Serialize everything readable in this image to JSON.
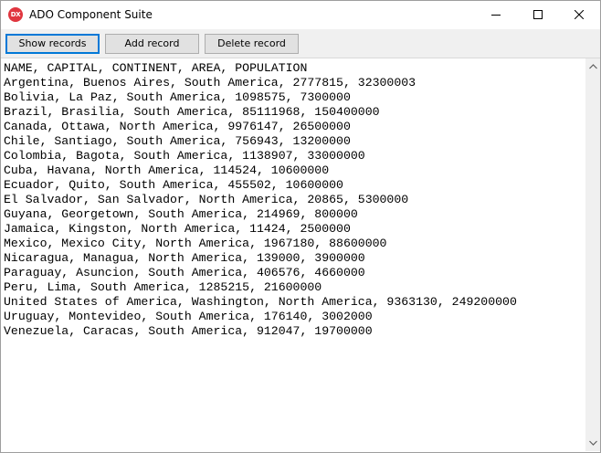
{
  "window": {
    "title": "ADO Component Suite",
    "icon_text": "DX",
    "icon_color": "#e0363f"
  },
  "toolbar": {
    "show_label": "Show records",
    "add_label": "Add record",
    "delete_label": "Delete record"
  },
  "memo": {
    "lines": [
      "NAME, CAPITAL, CONTINENT, AREA, POPULATION",
      "Argentina, Buenos Aires, South America, 2777815, 32300003",
      "Bolivia, La Paz, South America, 1098575, 7300000",
      "Brazil, Brasilia, South America, 85111968, 150400000",
      "Canada, Ottawa, North America, 9976147, 26500000",
      "Chile, Santiago, South America, 756943, 13200000",
      "Colombia, Bagota, South America, 1138907, 33000000",
      "Cuba, Havana, North America, 114524, 10600000",
      "Ecuador, Quito, South America, 455502, 10600000",
      "El Salvador, San Salvador, North America, 20865, 5300000",
      "Guyana, Georgetown, South America, 214969, 800000",
      "Jamaica, Kingston, North America, 11424, 2500000",
      "Mexico, Mexico City, North America, 1967180, 88600000",
      "Nicaragua, Managua, North America, 139000, 3900000",
      "Paraguay, Asuncion, South America, 406576, 4660000",
      "Peru, Lima, South America, 1285215, 21600000",
      "United States of America, Washington, North America, 9363130, 249200000",
      "Uruguay, Montevideo, South America, 176140, 3002000",
      "Venezuela, Caracas, South America, 912047, 19700000"
    ]
  },
  "icons": {
    "minimize": "minimize-icon",
    "maximize": "maximize-icon",
    "close": "close-icon",
    "scroll_up": "scroll-up-arrow-icon",
    "scroll_down": "scroll-down-arrow-icon"
  },
  "colors": {
    "accent": "#0078d7",
    "button_face": "#e1e1e1",
    "window_bg": "#f0f0f0"
  }
}
